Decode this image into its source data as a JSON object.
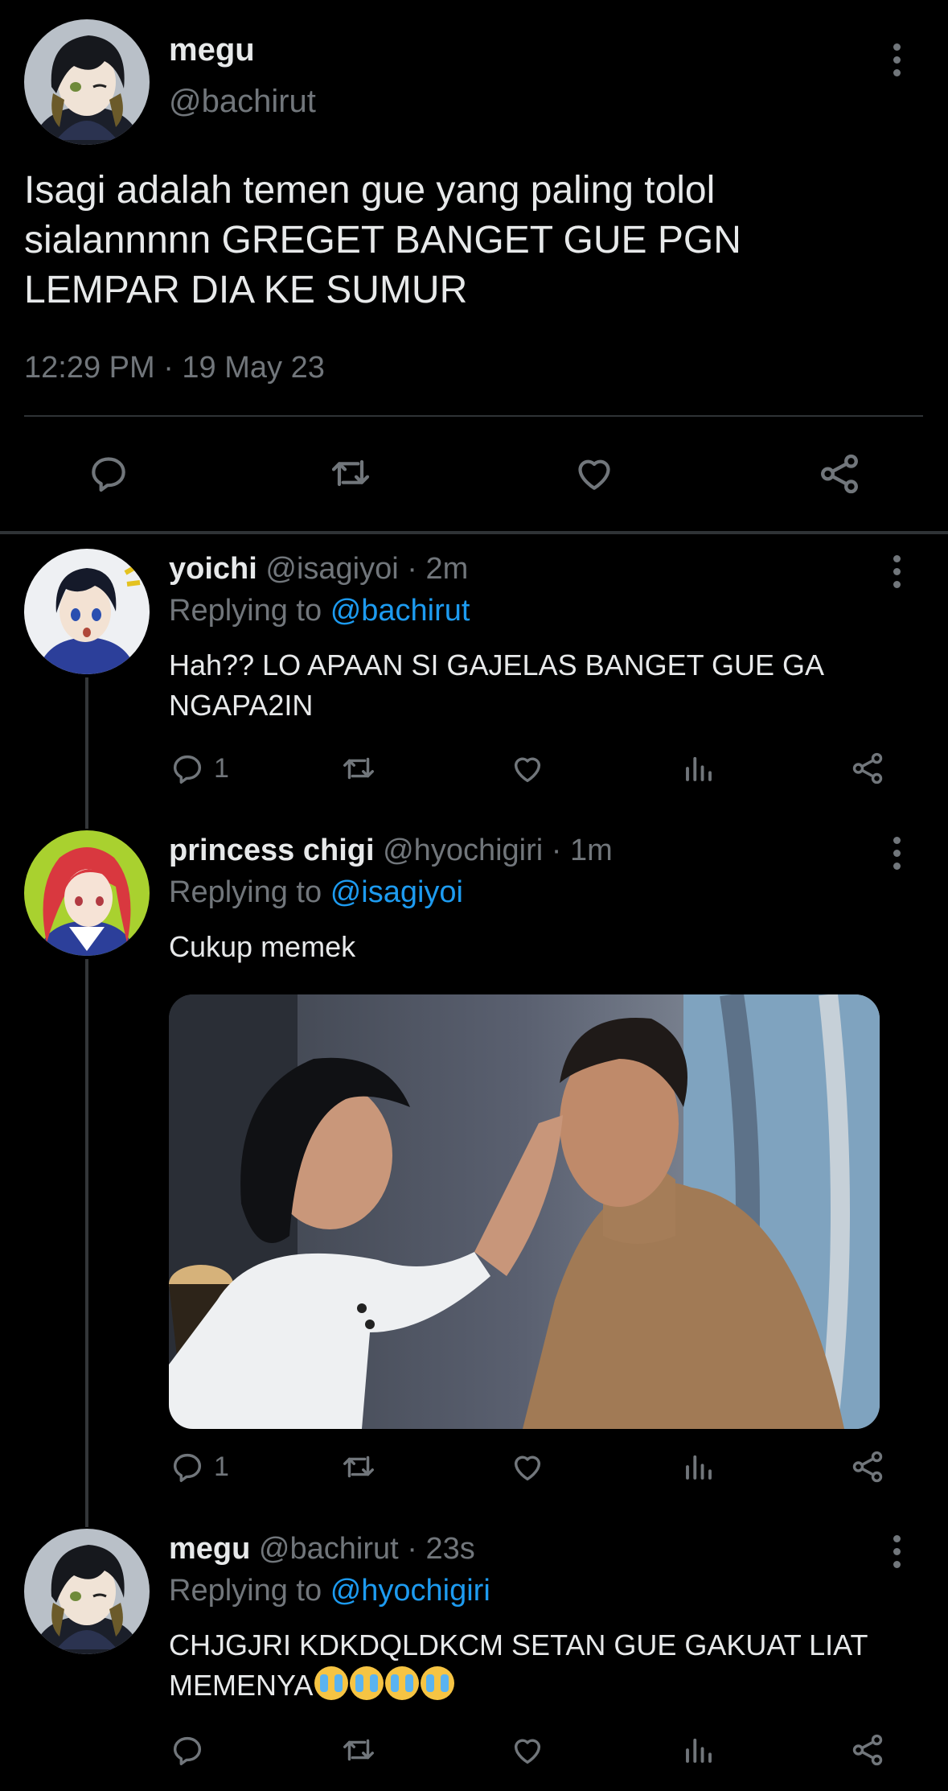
{
  "main_tweet": {
    "name": "megu",
    "handle": "@bachirut",
    "text": "Isagi adalah temen gue yang paling tolol sialannnnn GREGET BANGET GUE PGN LEMPAR DIA KE SUMUR",
    "timestamp": "12:29 PM · 19 May 23"
  },
  "replies": [
    {
      "name": "yoichi",
      "handle": "@isagiyoi",
      "time": "· 2m",
      "replying_label": "Replying to",
      "replying_to": "@bachirut",
      "text": "Hah?? LO APAAN SI GAJELAS BANGET GUE GA NGAPA2IN",
      "reply_count": "1"
    },
    {
      "name": "princess chigi",
      "handle": "@hyochigiri",
      "time": "· 1m",
      "replying_label": "Replying to",
      "replying_to": "@isagiyoi",
      "text": "Cukup memek",
      "reply_count": "1"
    },
    {
      "name": "megu",
      "handle": "@bachirut",
      "time": "· 23s",
      "replying_label": "Replying to",
      "replying_to": "@hyochigiri",
      "text": "CHJGJRI KDKDQLDKCM SETAN GUE GAKUAT LIAT MEMENYA",
      "reply_count": ""
    }
  ],
  "icons": [
    "reply-icon",
    "retweet-icon",
    "like-icon",
    "share-icon",
    "views-icon",
    "more-icon",
    "loudly-crying-emoji"
  ],
  "colors": {
    "background": "#000000",
    "text": "#e7e9ea",
    "secondary": "#71767b",
    "link": "#1d9bf0"
  }
}
